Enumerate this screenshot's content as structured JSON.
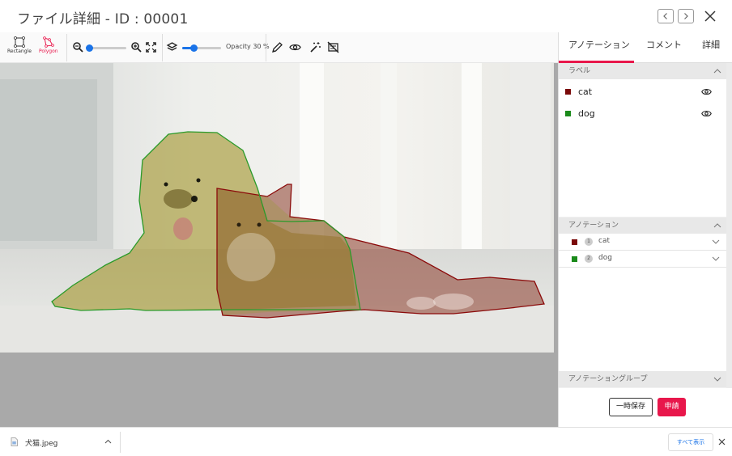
{
  "header": {
    "title": "ファイル詳細 - ID : 00001",
    "prev_icon": "chevron-left-icon",
    "next_icon": "chevron-right-icon",
    "close_icon": "close-icon"
  },
  "toolbar": {
    "rectangle_label": "Rectangle",
    "polygon_label": "Polygon",
    "active_tool": "Polygon",
    "active_color": "#e8174b",
    "zoom_level": 0.05,
    "opacity_level": 0.3,
    "opacity_label": "Opacity 30 %"
  },
  "panel": {
    "tabs": [
      {
        "label": "アノテーション",
        "active": true
      },
      {
        "label": "コメント",
        "active": false
      },
      {
        "label": "詳細",
        "active": false
      }
    ],
    "labels_section": "ラベル",
    "labels": [
      {
        "name": "cat",
        "color": "#7a0a0a"
      },
      {
        "name": "dog",
        "color": "#1a8a1a"
      }
    ],
    "annotations_section": "アノテーション",
    "annotations": [
      {
        "num": "1",
        "name": "cat",
        "color": "#7a0a0a"
      },
      {
        "num": "2",
        "name": "dog",
        "color": "#1a8a1a"
      }
    ],
    "groups_section": "アノテーショングループ",
    "save_label": "一時保存",
    "apply_label": "申請"
  },
  "downloads": {
    "file_name": "犬猫.jpeg",
    "show_all_label": "すべて表示"
  }
}
